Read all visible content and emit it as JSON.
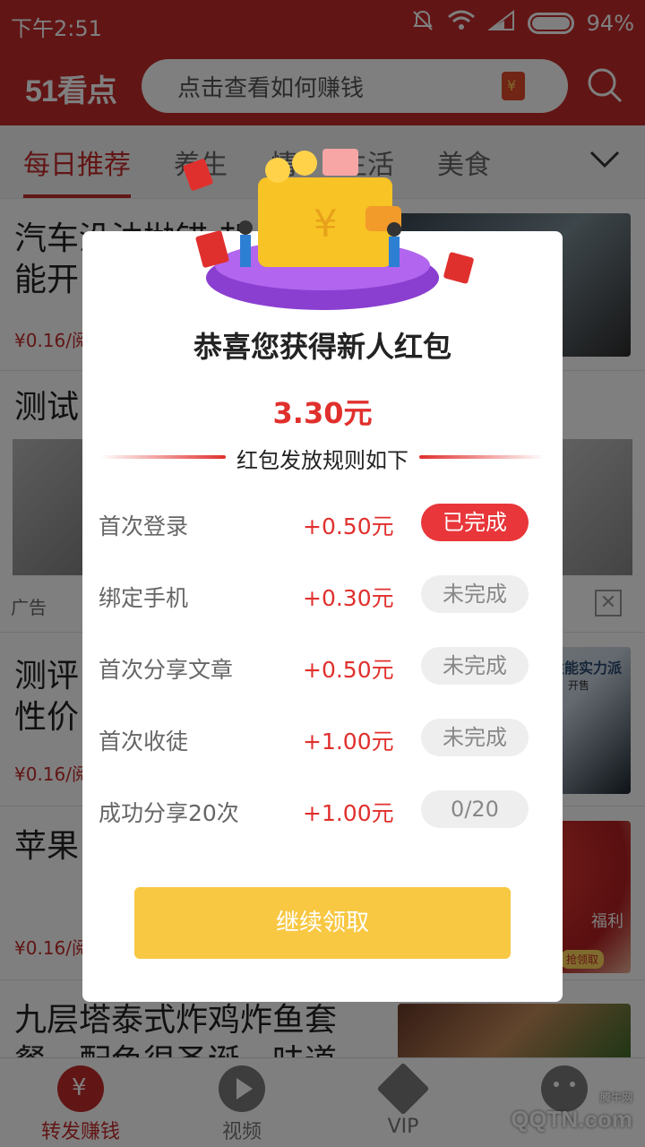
{
  "status_bar": {
    "time": "下午2:51",
    "battery": "94%"
  },
  "header": {
    "logo": "51看点",
    "search_placeholder": "点击查看如何赚钱"
  },
  "tabs": [
    {
      "label": "每日推荐",
      "active": true
    },
    {
      "label": "养生"
    },
    {
      "label": "情"
    },
    {
      "label": "生活"
    },
    {
      "label": "美食"
    }
  ],
  "articles": [
    {
      "title_line1": "汽车没油抛锚 却",
      "title_line2": "能开",
      "reward": "¥0.16/阅"
    },
    {
      "title_line1": "测试",
      "title_line2": "",
      "reward": ""
    },
    {
      "title_line1": "测评",
      "title_line2": "性价",
      "reward": "¥0.16/阅"
    },
    {
      "title_line1": "苹果",
      "title_line2": "",
      "reward": "¥0.16/阅"
    },
    {
      "title_line1": "九层塔泰式炸鸡炸鱼套",
      "title_line2": "餐，配色很圣诞，味道",
      "reward": ""
    }
  ],
  "ad": {
    "label": "广告",
    "close_icon": "close-icon"
  },
  "thumb_texts": {
    "phone_ad": "性能实力派",
    "phone_ad_sub": "开售",
    "apple_ad": "福利",
    "apple_ad_btn": "抢领取"
  },
  "modal": {
    "title": "恭喜您获得新人红包",
    "amount": "3.30元",
    "rules_header": "红包发放规则如下",
    "rules": [
      {
        "label": "首次登录",
        "amount": "+0.50元",
        "status": "已完成",
        "done": true
      },
      {
        "label": "绑定手机",
        "amount": "+0.30元",
        "status": "未完成",
        "done": false
      },
      {
        "label": "首次分享文章",
        "amount": "+0.50元",
        "status": "未完成",
        "done": false
      },
      {
        "label": "首次收徒",
        "amount": "+1.00元",
        "status": "未完成",
        "done": false
      },
      {
        "label": "成功分享20次",
        "amount": "+1.00元",
        "status": "0/20",
        "done": false
      }
    ],
    "continue_label": "继续领取"
  },
  "bottom_nav": [
    {
      "label": "转发赚钱",
      "icon": "money-bag-icon",
      "active": true
    },
    {
      "label": "视频",
      "icon": "play-icon"
    },
    {
      "label": "VIP",
      "icon": "vip-icon"
    },
    {
      "label": "",
      "icon": "face-icon"
    }
  ],
  "watermark": {
    "text": "QQTN.com",
    "small": "腾牛网"
  },
  "colors": {
    "brand_red": "#c52a2a",
    "accent_red": "#e0302d",
    "button_yellow": "#f8c843"
  }
}
